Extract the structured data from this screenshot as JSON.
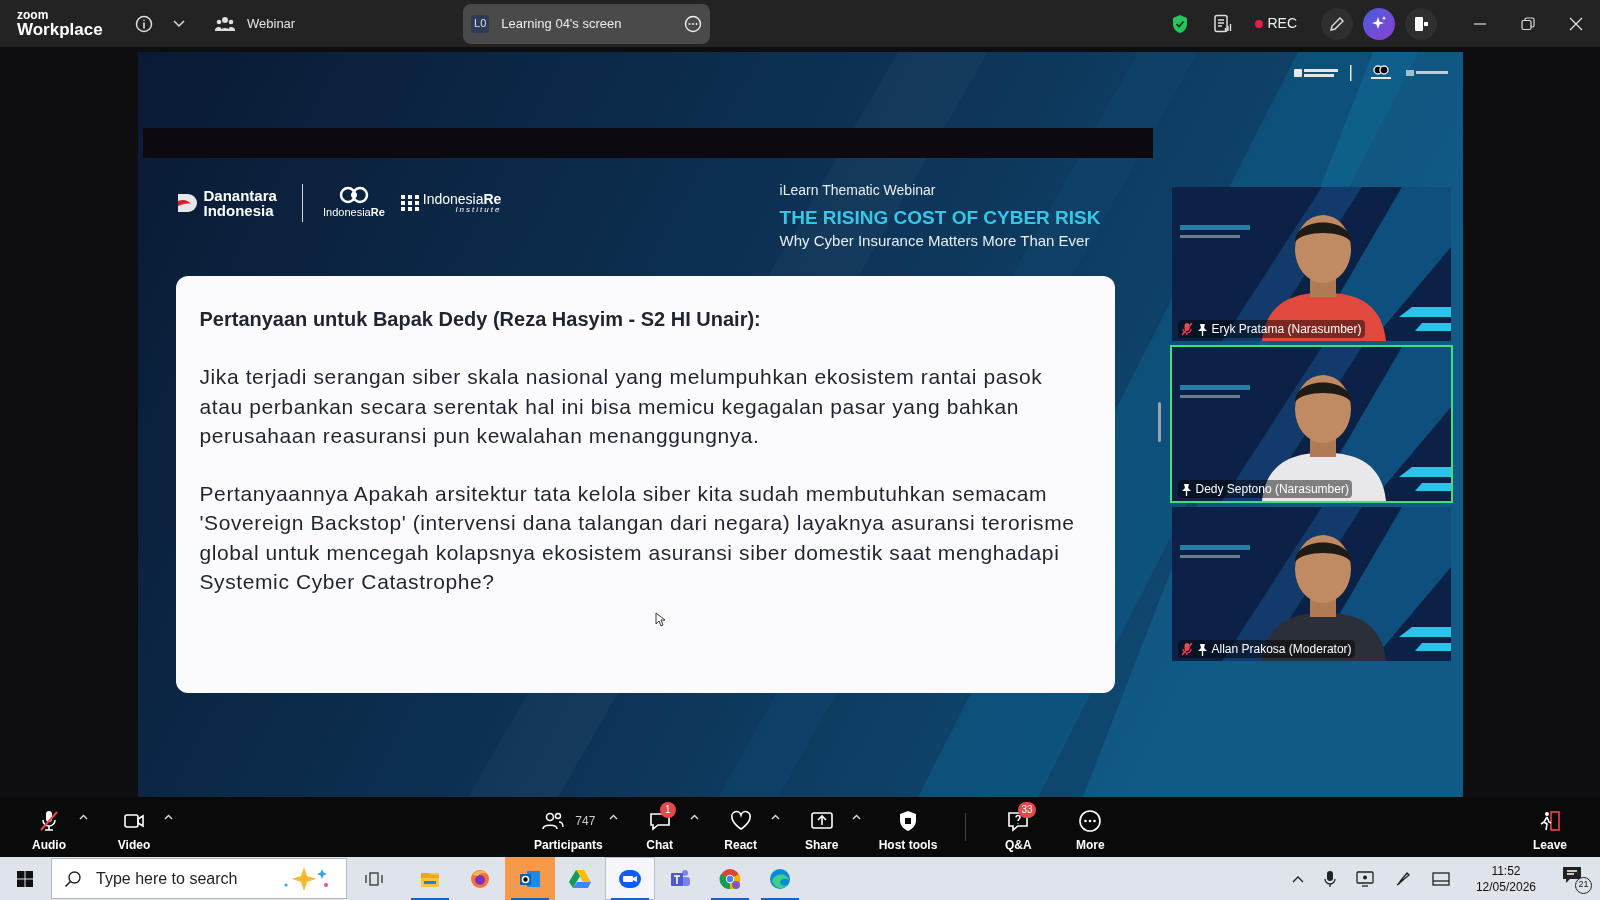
{
  "window": {
    "brand_small": "zoom",
    "brand": "Workplace",
    "meeting_type": "Webinar",
    "share_badge": "L0",
    "share_label": "Learning 04's screen",
    "rec_label": "REC",
    "recording": true
  },
  "slide": {
    "logo_1": "Danantara Indonesia",
    "logo_2": "Indonesia**Re**",
    "logo_3": "Indonesia**Re**",
    "logo_3_sub": "Institute",
    "kicker": "iLearn Thematic Webinar",
    "title": "THE RISING COST OF CYBER RISK",
    "subtitle": "Why Cyber Insurance Matters More Than Ever",
    "card": {
      "heading": "Pertanyaan untuk Bapak Dedy (Reza Hasyim - S2 HI Unair):",
      "paragraphs": [
        "Jika terjadi serangan siber skala nasional yang melumpuhkan ekosistem rantai pasok atau perbankan secara serentak hal ini bisa memicu kegagalan pasar yang bahkan perusahaan reasuransi pun kewalahan menanggungnya.",
        "Pertanyaannya Apakah arsitektur tata kelola siber kita sudah membutuhkan semacam 'Sovereign Backstop' (intervensi dana talangan dari negara) layaknya asuransi terorisme global untuk mencegah kolapsnya ekosistem asuransi siber domestik saat menghadapi Systemic Cyber Catastrophe?"
      ]
    }
  },
  "videos": [
    {
      "name": "Eryk Pratama (Narasumber)",
      "muted": true,
      "active_speaker": false,
      "kind": "picture"
    },
    {
      "name": "Dedy Septono (Narasumber)",
      "muted": false,
      "active_speaker": true,
      "kind": "picture"
    },
    {
      "name": "Allan Prakosa (Moderator)",
      "muted": true,
      "active_speaker": false,
      "kind": "picture"
    }
  ],
  "toolbar": {
    "left": [
      {
        "kind": "audio",
        "label": "Audio",
        "muted": true,
        "caret": true
      },
      {
        "kind": "video",
        "label": "Video",
        "caret": true
      }
    ],
    "center": [
      {
        "kind": "participants",
        "label": "Participants",
        "count": "747",
        "caret": true
      },
      {
        "kind": "chat",
        "label": "Chat",
        "badge": "1",
        "caret": true
      },
      {
        "kind": "react",
        "label": "React",
        "caret": true
      },
      {
        "kind": "share",
        "label": "Share",
        "caret": true
      },
      {
        "kind": "host",
        "label": "Host tools",
        "caret": false
      },
      {
        "kind": "qa",
        "label": "Q&A",
        "badge": "33",
        "caret": false
      },
      {
        "kind": "more",
        "label": "More",
        "caret": false
      }
    ],
    "right": [
      {
        "kind": "leave",
        "label": "Leave",
        "caret": false
      }
    ]
  },
  "taskbar": {
    "search_placeholder": "Type here to search",
    "apps": [
      {
        "kind": "explorer",
        "running": true,
        "selected": false,
        "flashing": false
      },
      {
        "kind": "firefox",
        "running": false,
        "selected": false,
        "flashing": false
      },
      {
        "kind": "outlook",
        "running": true,
        "selected": false,
        "flashing": true
      },
      {
        "kind": "drive",
        "running": false,
        "selected": false,
        "flashing": false
      },
      {
        "kind": "zoom",
        "running": true,
        "selected": true,
        "flashing": false
      },
      {
        "kind": "teams",
        "running": false,
        "selected": false,
        "flashing": false
      },
      {
        "kind": "chrome",
        "running": true,
        "selected": false,
        "flashing": false
      },
      {
        "kind": "edge",
        "running": true,
        "selected": false,
        "flashing": false
      }
    ],
    "time": "11:52",
    "date": "12/05/2026",
    "notifications": "21"
  }
}
